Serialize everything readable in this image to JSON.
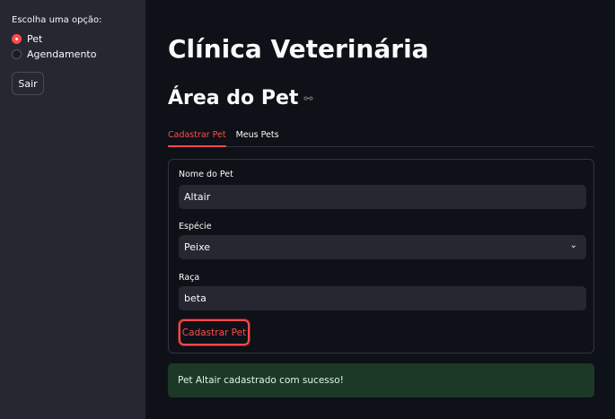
{
  "sidebar": {
    "label": "Escolha uma opção:",
    "options": [
      {
        "label": "Pet",
        "selected": true
      },
      {
        "label": "Agendamento",
        "selected": false
      }
    ],
    "logout": "Sair"
  },
  "main": {
    "title": "Clínica Veterinária",
    "subtitle": "Área do Pet",
    "tabs": [
      {
        "label": "Cadastrar Pet",
        "active": true
      },
      {
        "label": "Meus Pets",
        "active": false
      }
    ],
    "form": {
      "name_label": "Nome do Pet",
      "name_value": "Altair",
      "species_label": "Espécie",
      "species_value": "Peixe",
      "breed_label": "Raça",
      "breed_value": "beta",
      "submit": "Cadastrar Pet"
    },
    "success": "Pet Altair cadastrado com sucesso!"
  },
  "colors": {
    "accent": "#ff4b4b",
    "success_bg": "#1c3928"
  }
}
